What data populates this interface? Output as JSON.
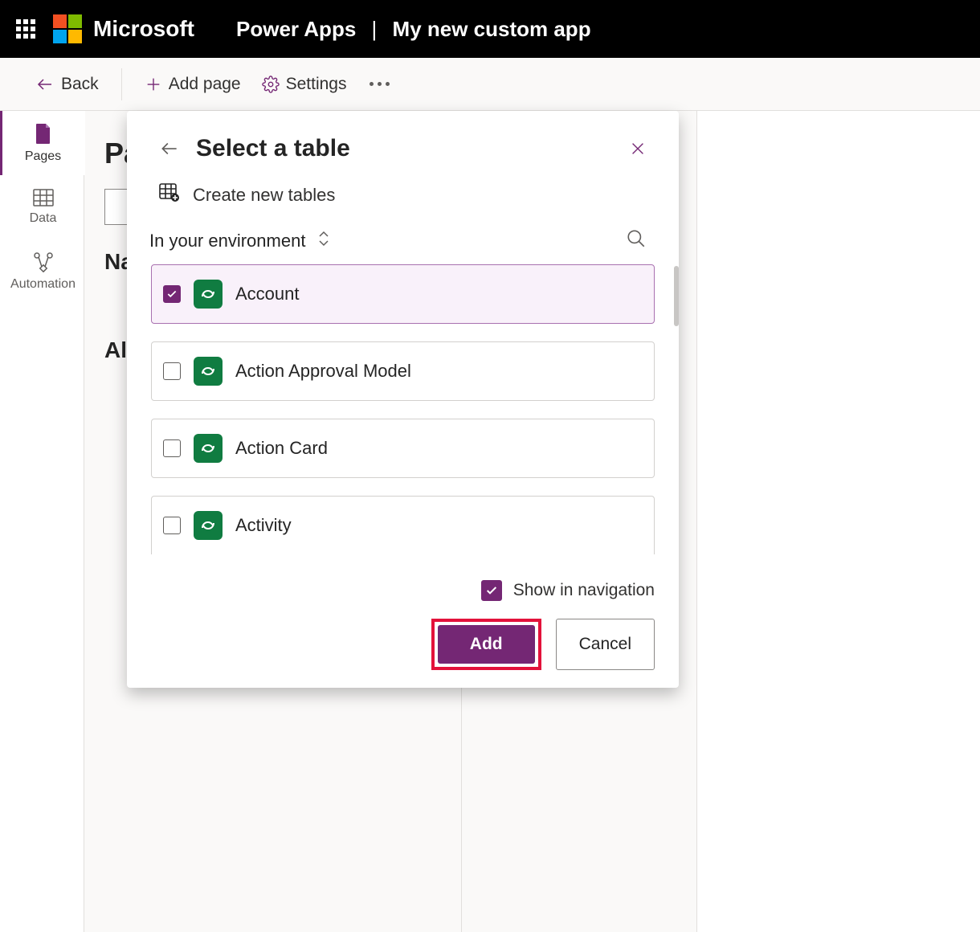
{
  "header": {
    "brand": "Microsoft",
    "app": "Power Apps",
    "separator": "|",
    "subtitle": "My new custom app"
  },
  "toolbar": {
    "back": "Back",
    "add_page": "Add page",
    "settings": "Settings"
  },
  "rail": {
    "pages": "Pages",
    "data": "Data",
    "automation": "Automation"
  },
  "background": {
    "heading": "Pa",
    "na": "Na",
    "al": "Al"
  },
  "modal": {
    "title": "Select a table",
    "create_new": "Create new tables",
    "filter_label": "In your environment",
    "tables": [
      {
        "label": "Account",
        "checked": true
      },
      {
        "label": "Action Approval Model",
        "checked": false
      },
      {
        "label": "Action Card",
        "checked": false
      },
      {
        "label": "Activity",
        "checked": false
      }
    ],
    "show_in_nav": "Show in navigation",
    "add": "Add",
    "cancel": "Cancel"
  }
}
